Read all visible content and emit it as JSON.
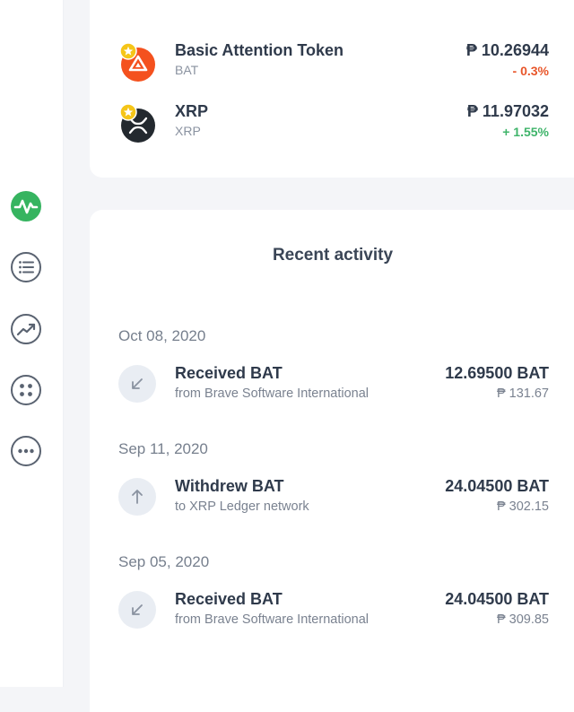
{
  "sidebar": {
    "items": [
      {
        "icon": "activity-icon",
        "active": true
      },
      {
        "icon": "list-icon"
      },
      {
        "icon": "trending-up-icon"
      },
      {
        "icon": "apps-grid-icon"
      },
      {
        "icon": "more-icon"
      }
    ],
    "active_color": "#36b460"
  },
  "assets": [
    {
      "name": "Basic Attention Token",
      "symbol": "BAT",
      "price": "₱ 10.26944",
      "change": "- 0.3%",
      "change_direction": "down",
      "logo": "bat-logo-icon",
      "favorite": true
    },
    {
      "name": "XRP",
      "symbol": "XRP",
      "price": "₱ 11.97032",
      "change": "+ 1.55%",
      "change_direction": "up",
      "logo": "xrp-logo-icon",
      "favorite": true
    }
  ],
  "activity": {
    "title": "Recent activity",
    "groups": [
      {
        "date": "Oct 08, 2020",
        "entries": [
          {
            "type": "received",
            "icon": "arrow-down-left-icon",
            "title": "Received BAT",
            "subtitle": "from Brave Software International",
            "amount": "12.69500 BAT",
            "fiat": "₱ 131.67"
          }
        ]
      },
      {
        "date": "Sep 11, 2020",
        "entries": [
          {
            "type": "withdrew",
            "icon": "arrow-up-icon",
            "title": "Withdrew BAT",
            "subtitle": "to XRP Ledger network",
            "amount": "24.04500 BAT",
            "fiat": "₱ 302.15"
          }
        ]
      },
      {
        "date": "Sep 05, 2020",
        "entries": [
          {
            "type": "received",
            "icon": "arrow-down-left-icon",
            "title": "Received BAT",
            "subtitle": "from Brave Software International",
            "amount": "24.04500 BAT",
            "fiat": "₱ 309.85"
          }
        ]
      }
    ]
  },
  "colors": {
    "positive": "#3fb46a",
    "negative": "#e8562a",
    "bat_orange": "#f4511e",
    "favorite_star": "#f5c518"
  }
}
